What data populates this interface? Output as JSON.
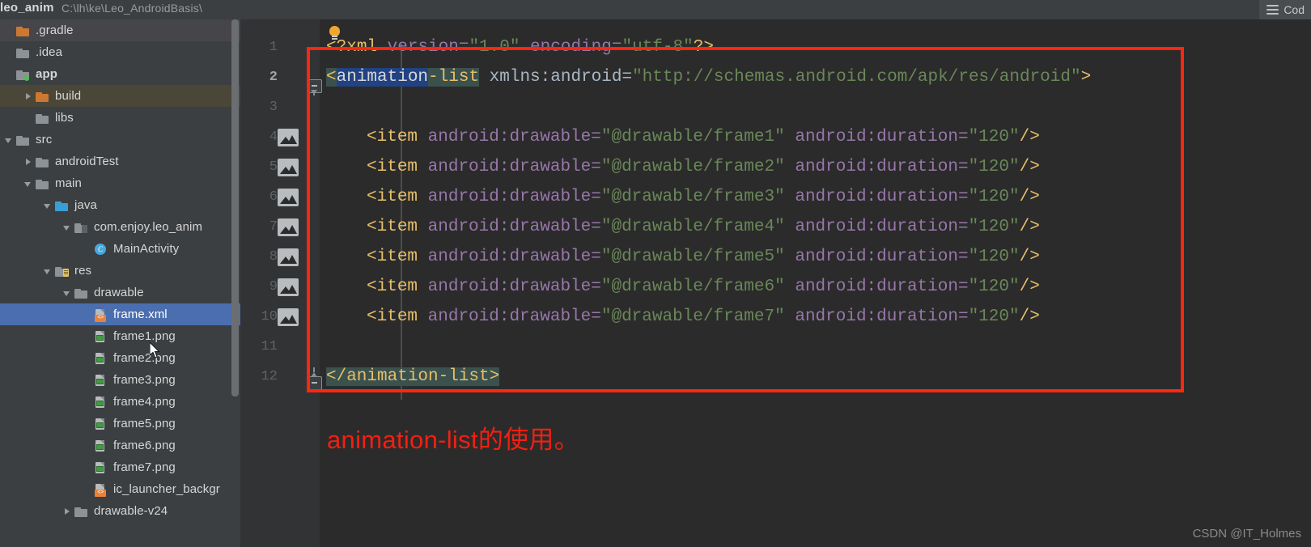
{
  "topbar": {
    "project_name": "leo_anim",
    "project_path": "C:\\lh\\ke\\Leo_AndroidBasis\\",
    "code_tab_label": "Cod",
    "menu_icon": "hamburger-icon"
  },
  "tree": {
    "items": [
      {
        "label": ".gradle",
        "indent": 0,
        "arrow": "none",
        "icon": "folder-orange",
        "state": "hover",
        "bold": false
      },
      {
        "label": ".idea",
        "indent": 0,
        "arrow": "none",
        "icon": "folder",
        "state": "normal",
        "bold": false
      },
      {
        "label": "app",
        "indent": 0,
        "arrow": "none",
        "icon": "folder-module",
        "state": "normal",
        "bold": true
      },
      {
        "label": "build",
        "indent": 1,
        "arrow": "right",
        "icon": "folder-orange",
        "state": "hover2",
        "bold": false
      },
      {
        "label": "libs",
        "indent": 1,
        "arrow": "none",
        "icon": "folder",
        "state": "normal",
        "bold": false
      },
      {
        "label": "src",
        "indent": 0,
        "arrow": "down",
        "icon": "folder",
        "state": "normal",
        "bold": false
      },
      {
        "label": "androidTest",
        "indent": 1,
        "arrow": "right",
        "icon": "folder",
        "state": "normal",
        "bold": false
      },
      {
        "label": "main",
        "indent": 1,
        "arrow": "down",
        "icon": "folder",
        "state": "normal",
        "bold": false
      },
      {
        "label": "java",
        "indent": 2,
        "arrow": "down",
        "icon": "folder-blue",
        "state": "normal",
        "bold": false
      },
      {
        "label": "com.enjoy.leo_anim",
        "indent": 3,
        "arrow": "down",
        "icon": "folder-package",
        "state": "normal",
        "bold": false
      },
      {
        "label": "MainActivity",
        "indent": 4,
        "arrow": "none",
        "icon": "class",
        "state": "normal",
        "bold": false
      },
      {
        "label": "res",
        "indent": 2,
        "arrow": "down",
        "icon": "folder-res",
        "state": "normal",
        "bold": false
      },
      {
        "label": "drawable",
        "indent": 3,
        "arrow": "down",
        "icon": "folder",
        "state": "normal",
        "bold": false
      },
      {
        "label": "frame.xml",
        "indent": 4,
        "arrow": "none",
        "icon": "file-xml",
        "state": "selected",
        "bold": false
      },
      {
        "label": "frame1.png",
        "indent": 4,
        "arrow": "none",
        "icon": "file-png",
        "state": "normal",
        "bold": false
      },
      {
        "label": "frame2.png",
        "indent": 4,
        "arrow": "none",
        "icon": "file-png",
        "state": "normal",
        "bold": false
      },
      {
        "label": "frame3.png",
        "indent": 4,
        "arrow": "none",
        "icon": "file-png",
        "state": "normal",
        "bold": false
      },
      {
        "label": "frame4.png",
        "indent": 4,
        "arrow": "none",
        "icon": "file-png",
        "state": "normal",
        "bold": false
      },
      {
        "label": "frame5.png",
        "indent": 4,
        "arrow": "none",
        "icon": "file-png",
        "state": "normal",
        "bold": false
      },
      {
        "label": "frame6.png",
        "indent": 4,
        "arrow": "none",
        "icon": "file-png",
        "state": "normal",
        "bold": false
      },
      {
        "label": "frame7.png",
        "indent": 4,
        "arrow": "none",
        "icon": "file-png",
        "state": "normal",
        "bold": false
      },
      {
        "label": "ic_launcher_backgr",
        "indent": 4,
        "arrow": "none",
        "icon": "file-xml",
        "state": "normal",
        "bold": false
      },
      {
        "label": "drawable-v24",
        "indent": 3,
        "arrow": "right",
        "icon": "folder",
        "state": "normal",
        "bold": false
      }
    ]
  },
  "editor": {
    "gutter": {
      "line_numbers": [
        "1",
        "2",
        "3",
        "4",
        "5",
        "6",
        "7",
        "8",
        "9",
        "10",
        "11",
        "12"
      ],
      "active_line": "2",
      "image_preview_lines": [
        "4",
        "5",
        "6",
        "7",
        "8",
        "9",
        "10"
      ]
    },
    "lines": [
      {
        "n": 1,
        "indent": 0,
        "text": "<?xml version=\"1.0\" encoding=\"utf-8\"?>"
      },
      {
        "n": 2,
        "indent": 0,
        "text": "<animation-list xmlns:android=\"http://schemas.android.com/apk/res/android\">"
      },
      {
        "n": 3,
        "indent": 0,
        "text": ""
      },
      {
        "n": 4,
        "indent": 1,
        "text": "<item android:drawable=\"@drawable/frame1\" android:duration=\"120\"/>"
      },
      {
        "n": 5,
        "indent": 1,
        "text": "<item android:drawable=\"@drawable/frame2\" android:duration=\"120\"/>"
      },
      {
        "n": 6,
        "indent": 1,
        "text": "<item android:drawable=\"@drawable/frame3\" android:duration=\"120\"/>"
      },
      {
        "n": 7,
        "indent": 1,
        "text": "<item android:drawable=\"@drawable/frame4\" android:duration=\"120\"/>"
      },
      {
        "n": 8,
        "indent": 1,
        "text": "<item android:drawable=\"@drawable/frame5\" android:duration=\"120\"/>"
      },
      {
        "n": 9,
        "indent": 1,
        "text": "<item android:drawable=\"@drawable/frame6\" android:duration=\"120\"/>"
      },
      {
        "n": 10,
        "indent": 1,
        "text": "<item android:drawable=\"@drawable/frame7\" android:duration=\"120\"/>"
      },
      {
        "n": 11,
        "indent": 0,
        "text": ""
      },
      {
        "n": 12,
        "indent": 0,
        "text": "</animation-list>"
      }
    ],
    "fragments": {
      "l1_open": "<?",
      "l1_name": "xml",
      "l1_a1": " version=",
      "l1_v1": "\"1.0\"",
      "l1_a2": " encoding=",
      "l1_v2": "\"utf-8\"",
      "l1_close": "?>",
      "l2_lt": "<",
      "l2_sel": "animation",
      "l2_rest": "-list",
      "l2_attr": " xmlns:android=",
      "l2_val": "\"http://schemas.android.com/apk/res/android\"",
      "l2_gt": ">",
      "item_lt": "<",
      "item_tag": "item",
      "item_attr1": " android:drawable=",
      "item_val1_pre": "\"@drawable/frame",
      "item_val1_post": "\"",
      "item_attr2": " android:duration=",
      "item_val2": "\"120\"",
      "item_end": "/>",
      "l12": "</animation-list>"
    },
    "frame_numbers": [
      "1",
      "2",
      "3",
      "4",
      "5",
      "6",
      "7"
    ]
  },
  "annotation": {
    "caption": "animation-list的使用。",
    "box_color": "#fe2712",
    "caption_color": "#f41f10"
  },
  "watermark": "CSDN @IT_Holmes"
}
